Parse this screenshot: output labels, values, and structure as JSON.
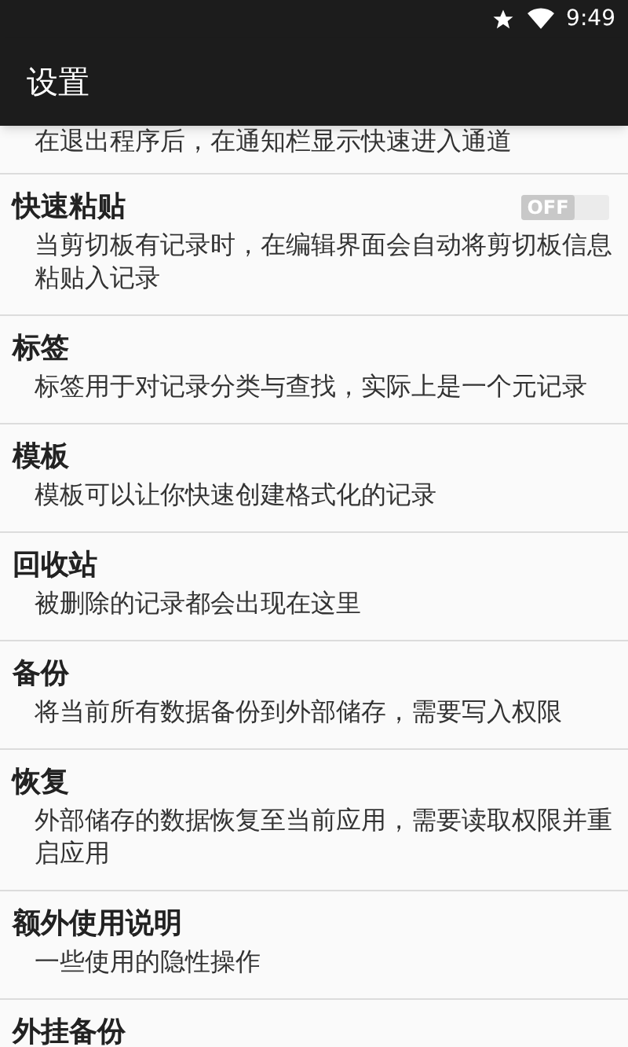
{
  "status_bar": {
    "time": "9:49"
  },
  "app_bar": {
    "title": "设置"
  },
  "settings": [
    {
      "kind": "partial",
      "summary": "在退出程序后，在通知栏显示快速进入通道"
    },
    {
      "kind": "switch",
      "title": "快速粘贴",
      "summary": "当剪切板有记录时，在编辑界面会自动将剪切板信息粘贴入记录",
      "toggle_label": "OFF",
      "checked": false
    },
    {
      "kind": "item",
      "title": "标签",
      "summary": "标签用于对记录分类与查找，实际上是一个元记录"
    },
    {
      "kind": "item",
      "title": "模板",
      "summary": "模板可以让你快速创建格式化的记录"
    },
    {
      "kind": "item",
      "title": "回收站",
      "summary": "被删除的记录都会出现在这里"
    },
    {
      "kind": "item",
      "title": "备份",
      "summary": "将当前所有数据备份到外部储存，需要写入权限"
    },
    {
      "kind": "item",
      "title": "恢复",
      "summary": "外部储存的数据恢复至当前应用，需要读取权限并重启应用"
    },
    {
      "kind": "item",
      "title": "额外使用说明",
      "summary": "一些使用的隐性操作"
    },
    {
      "kind": "item",
      "title": "外挂备份"
    }
  ]
}
